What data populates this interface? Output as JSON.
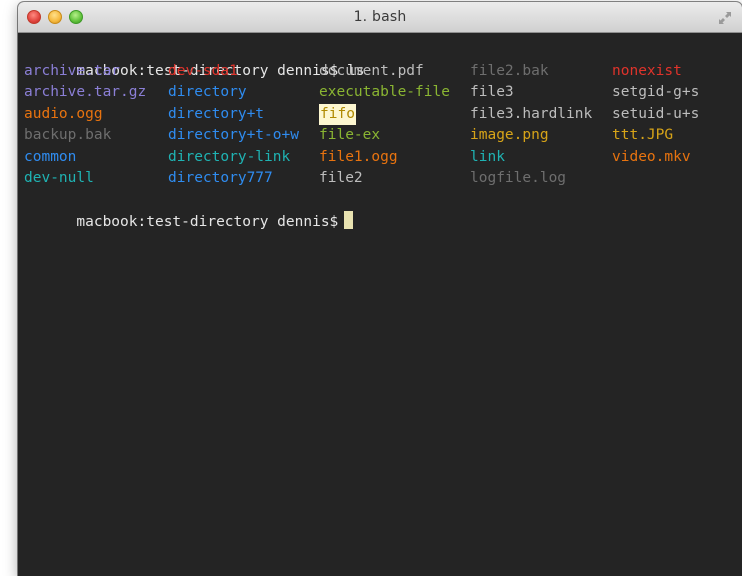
{
  "window": {
    "title": "1. bash"
  },
  "terminal": {
    "prompt_line_1": "macbook:test-directory dennis$ ls",
    "prompt_line_2": "macbook:test-directory dennis$",
    "rows": [
      [
        {
          "text": "archive.tar",
          "color": "#8b7fd6"
        },
        {
          "text": "dev-sda1",
          "color": "#e0332b"
        },
        {
          "text": "document.pdf",
          "color": "#bdbdbd"
        },
        {
          "text": "file2.bak",
          "color": "#6e6e6e"
        },
        {
          "text": "nonexist",
          "color": "#e0332b"
        }
      ],
      [
        {
          "text": "archive.tar.gz",
          "color": "#8b7fd6"
        },
        {
          "text": "directory",
          "color": "#2f8cf0"
        },
        {
          "text": "executable-file",
          "color": "#8ab532"
        },
        {
          "text": "file3",
          "color": "#bdbdbd"
        },
        {
          "text": "setgid-g+s",
          "color": "#bdbdbd"
        }
      ],
      [
        {
          "text": "audio.ogg",
          "color": "#e8730f"
        },
        {
          "text": "directory+t",
          "color": "#2f8cf0"
        },
        {
          "text": "fifo",
          "color": "#f5c400",
          "bg": "#fdf7d0",
          "fg": "#b08a00"
        },
        {
          "text": "file3.hardlink",
          "color": "#bdbdbd"
        },
        {
          "text": "setuid-u+s",
          "color": "#bdbdbd"
        }
      ],
      [
        {
          "text": "backup.bak",
          "color": "#6e6e6e"
        },
        {
          "text": "directory+t-o+w",
          "color": "#2f8cf0"
        },
        {
          "text": "file-ex",
          "color": "#8ab532"
        },
        {
          "text": "image.png",
          "color": "#d7a418"
        },
        {
          "text": "ttt.JPG",
          "color": "#d7a418"
        }
      ],
      [
        {
          "text": "common",
          "color": "#2f8cf0"
        },
        {
          "text": "directory-link",
          "color": "#1fb3b3"
        },
        {
          "text": "file1.ogg",
          "color": "#e8730f"
        },
        {
          "text": "link",
          "color": "#1fb3b3"
        },
        {
          "text": "video.mkv",
          "color": "#e8730f"
        }
      ],
      [
        {
          "text": "dev-null",
          "color": "#1fb3b3"
        },
        {
          "text": "directory777",
          "color": "#2f8cf0"
        },
        {
          "text": "file2",
          "color": "#bdbdbd"
        },
        {
          "text": "logfile.log",
          "color": "#6e6e6e"
        },
        {
          "text": "",
          "color": "#bdbdbd"
        }
      ]
    ],
    "colors": {
      "background": "#242424",
      "prompt": "#e6e6e6",
      "cursor": "#e8e2b0"
    }
  }
}
